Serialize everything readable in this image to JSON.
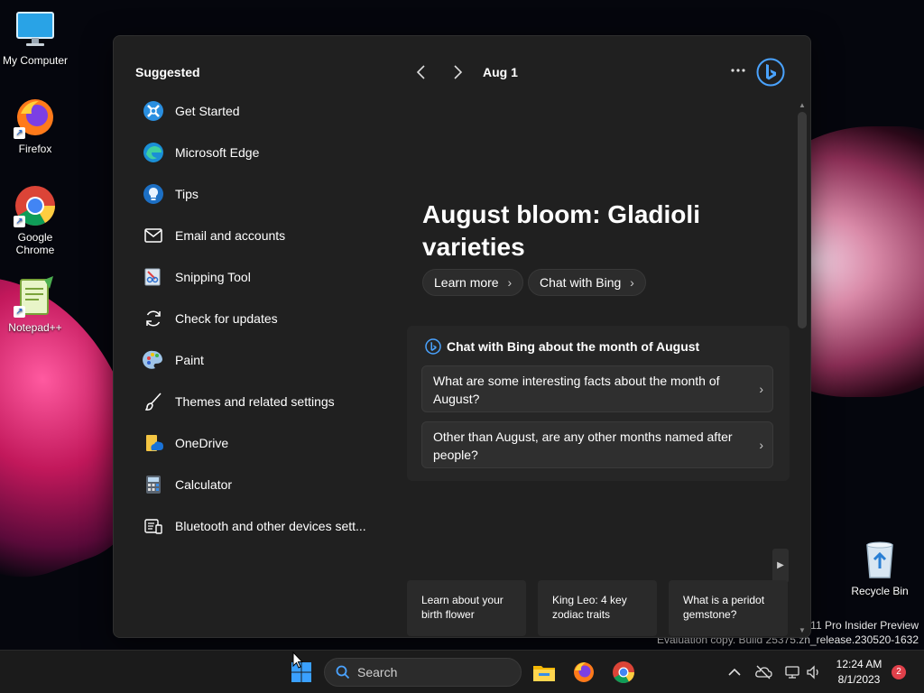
{
  "desktop": {
    "icons": [
      {
        "label": "My Computer"
      },
      {
        "label": "Firefox"
      },
      {
        "label": "Google Chrome"
      },
      {
        "label": "Notepad++"
      },
      {
        "label": "Recycle Bin"
      }
    ],
    "watermark": {
      "line1": "11 Pro Insider Preview",
      "line2": "Evaluation copy. Build 25375.zn_release.230520-1632"
    }
  },
  "start": {
    "suggested_title": "Suggested",
    "suggested": [
      {
        "label": "Get Started",
        "icon": "get-started-icon"
      },
      {
        "label": "Microsoft Edge",
        "icon": "edge-icon"
      },
      {
        "label": "Tips",
        "icon": "tips-icon"
      },
      {
        "label": "Email and accounts",
        "icon": "mail-icon"
      },
      {
        "label": "Snipping Tool",
        "icon": "snipping-tool-icon"
      },
      {
        "label": "Check for updates",
        "icon": "refresh-icon"
      },
      {
        "label": "Paint",
        "icon": "paint-icon"
      },
      {
        "label": "Themes and related settings",
        "icon": "brush-icon"
      },
      {
        "label": "OneDrive",
        "icon": "onedrive-icon"
      },
      {
        "label": "Calculator",
        "icon": "calculator-icon"
      },
      {
        "label": "Bluetooth and other devices sett...",
        "icon": "devices-icon"
      }
    ],
    "date": "Aug 1",
    "headline": "August bloom: Gladioli varieties",
    "learn_more": "Learn more",
    "chat_with_bing": "Chat with Bing",
    "chat_card": {
      "title": "Chat with Bing about the month of August",
      "questions": [
        "What are some interesting facts about the month of August?",
        "Other than August, are any other months named after people?"
      ]
    },
    "cards": [
      "Learn about your birth flower",
      "King Leo: 4 key zodiac traits",
      "What is a peridot gemstone?"
    ]
  },
  "taskbar": {
    "search_placeholder": "Search",
    "time": "12:24 AM",
    "date": "8/1/2023",
    "notifications": "2"
  },
  "colors": {
    "panel_bg": "#202020",
    "accent_blue": "#4aa3ff",
    "badge_red": "#e0404a"
  }
}
